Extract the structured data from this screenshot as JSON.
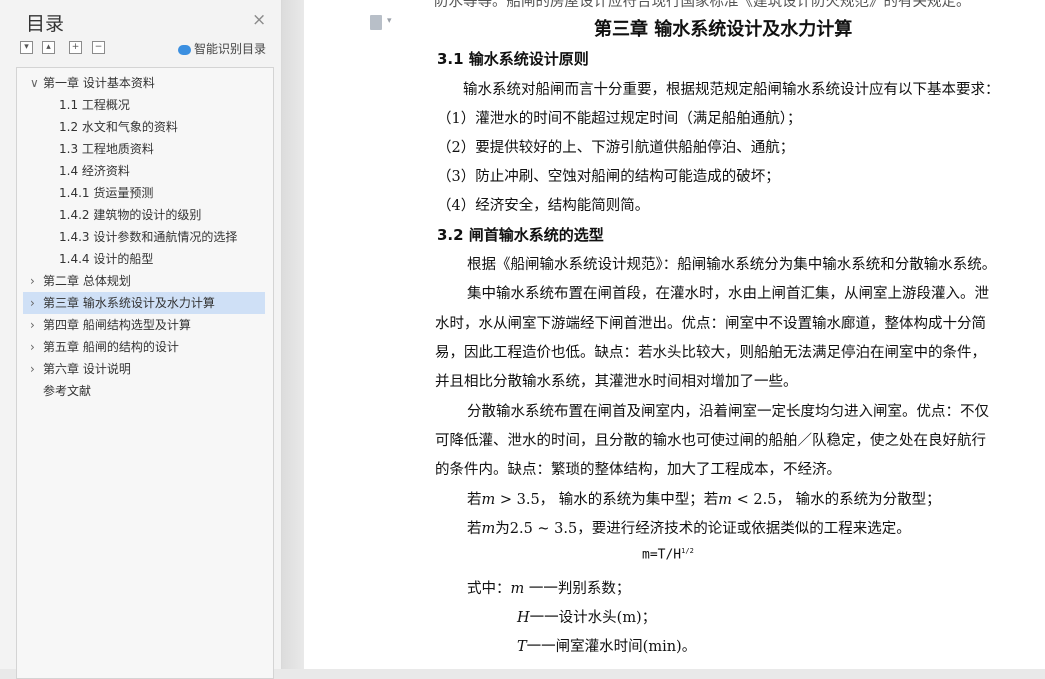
{
  "toc": {
    "title": "目录",
    "close_label": "×",
    "toolbar": {
      "collapse_all": "▾",
      "expand_up": "▴",
      "add": "+",
      "remove": "−"
    },
    "smart_label": "智能识别目录",
    "items": [
      {
        "label": "第一章  设计基本资料",
        "chevron": "∨"
      },
      {
        "label": "1.1  工程概况"
      },
      {
        "label": "1.2  水文和气象的资料"
      },
      {
        "label": "1.3  工程地质资料"
      },
      {
        "label": "1.4  经济资料"
      },
      {
        "label": "1.4.1  货运量预测"
      },
      {
        "label": "1.4.2  建筑物的设计的级别"
      },
      {
        "label": "1.4.3  设计参数和通航情况的选择"
      },
      {
        "label": "1.4.4  设计的船型"
      },
      {
        "label": "第二章  总体规划",
        "chevron": "›"
      },
      {
        "label": "第三章  输水系统设计及水力计算",
        "chevron": "›"
      },
      {
        "label": "第四章  船闸结构选型及计算",
        "chevron": "›"
      },
      {
        "label": "第五章  船闸的结构的设计",
        "chevron": "›"
      },
      {
        "label": "第六章  设计说明",
        "chevron": "›"
      },
      {
        "label": "参考文献"
      }
    ]
  },
  "doc": {
    "cut_line": "防水等等。船闸的房屋设计应符合现行国家标准《建筑设计防火规范》的有关规定。",
    "chapter_title": "第三章  输水系统设计及水力计算",
    "sec1_title": "3.1 输水系统设计原则",
    "p1": "输水系统对船闸而言十分重要，根据规范规定船闸输水系统设计应有以下基本要求：",
    "list": [
      "（1）灌泄水的时间不能超过规定时间（满足船舶通航）；",
      "（2）要提供较好的上、下游引航道供船舶停泊、通航；",
      "（3）防止冲刷、空蚀对船闸的结构可能造成的破坏；",
      "（4）经济安全，结构能简则简。"
    ],
    "sec2_title": "3.2 闸首输水系统的选型",
    "p2": "根据《船闸输水系统设计规范》：船闸输水系统分为集中输水系统和分散输水系统。",
    "p3": [
      "集中输水系统布置在闸首段，在灌水时，水由上闸首汇集，从闸室上游段灌入。泄",
      "水时，水从闸室下游端经下闸首泄出。优点：闸室中不设置输水廊道，整体构成十分简",
      "易，因此工程造价也低。缺点：若水头比较大，则船舶无法满足停泊在闸室中的条件，",
      "并且相比分散输水系统，其灌泄水时间相对增加了一些。"
    ],
    "p4": [
      "分散输水系统布置在闸首及闸室内，沿着闸室一定长度均匀进入闸室。优点：不仅",
      "可降低灌、泄水的时间，且分散的输水也可使过闸的船舶／队稳定，使之处在良好航行",
      "的条件内。缺点：繁琐的整体结构，加大了工程成本，不经济。"
    ],
    "crit1": {
      "pre": "若",
      "var": "m",
      "op1": " > 3.5，  输水的系统为集中型；若",
      "op2": " < 2.5，  输水的系统为分散型；"
    },
    "crit2": {
      "pre": "若",
      "mid": "为2.5 ~ 3.5，要进行经济技术的论证或依据类似的工程来选定。"
    },
    "formula": "m=T/H",
    "formula_sup": "1/2",
    "where_label": "式中：",
    "defs": [
      {
        "var": "m",
        "text": "一一判别系数；"
      },
      {
        "var": "H",
        "text": "一一设计水头(m)；"
      },
      {
        "var": "T",
        "text": "一一闸室灌水时间(min)。"
      }
    ]
  }
}
